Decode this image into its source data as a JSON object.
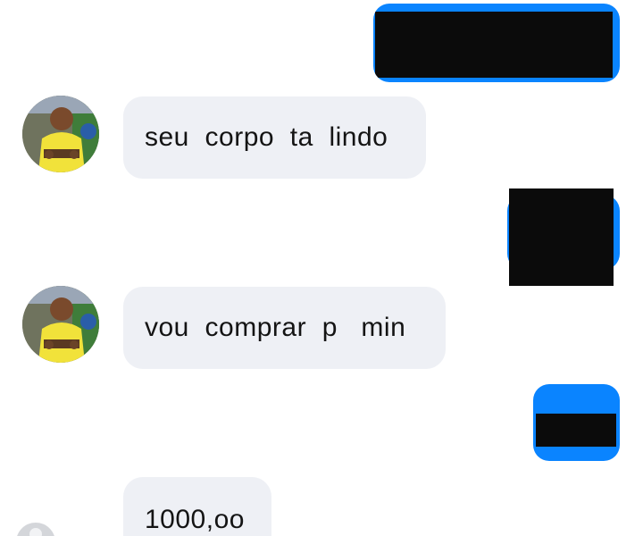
{
  "conversation": {
    "messages": [
      {
        "direction": "outgoing",
        "text_redacted": true
      },
      {
        "direction": "incoming",
        "text": "seu  corpo  ta  lindo",
        "avatar_icon": "contact-avatar"
      },
      {
        "direction": "outgoing",
        "text_redacted": true
      },
      {
        "direction": "incoming",
        "text": "vou  comprar  p   min",
        "avatar_icon": "contact-avatar"
      },
      {
        "direction": "outgoing",
        "text_redacted": true
      },
      {
        "direction": "incoming",
        "text": "1000,oo",
        "avatar_icon": "contact-avatar"
      }
    ]
  },
  "colors": {
    "outgoing_bubble": "#0a84ff",
    "incoming_bubble": "#eef0f5",
    "redaction": "#0b0b0b",
    "text": "#141414"
  }
}
